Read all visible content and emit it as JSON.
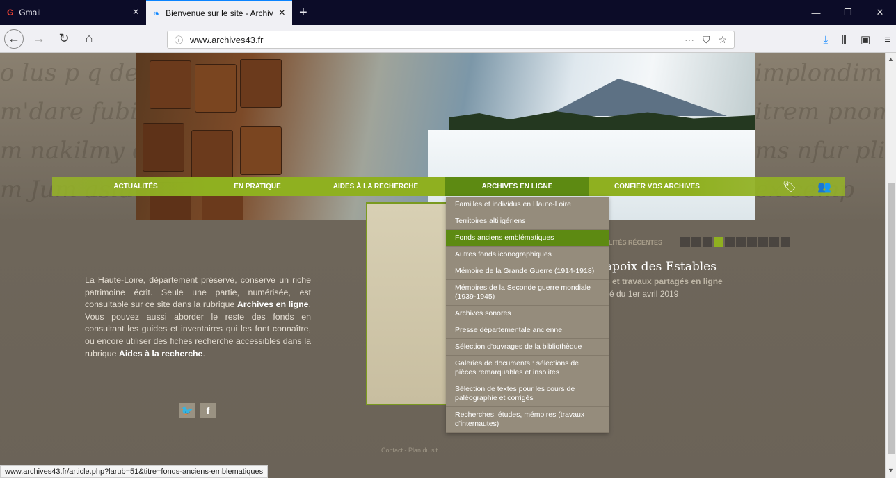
{
  "browser": {
    "tabs": [
      {
        "label": "Gmail",
        "icon": "google-icon"
      },
      {
        "label": "Bienvenue sur le site - Archives",
        "icon": "site-favicon"
      }
    ],
    "new_tab": "+",
    "url": "www.archives43.fr",
    "status_url": "www.archives43.fr/article.php?larub=51&titre=fonds-anciens-emblematiques"
  },
  "site": {
    "menu": [
      "ACTUALITÉS",
      "EN PRATIQUE",
      "AIDES À LA RECHERCHE",
      "ARCHIVES EN LIGNE",
      "CONFIER VOS ARCHIVES"
    ],
    "active_menu": "ARCHIVES EN LIGNE",
    "dropdown": [
      "Familles et individus en Haute-Loire",
      "Territoires altiligériens",
      "Fonds anciens emblématiques",
      "Autres fonds iconographiques",
      "Mémoire de la Grande Guerre (1914-1918)",
      "Mémoires de la Seconde guerre mondiale (1939-1945)",
      "Archives sonores",
      "Presse départementale ancienne",
      "Sélection d'ouvrages de la bibliothèque",
      "Galeries de documents : sélections de pièces remarquables et insolites",
      "Sélection de textes pour les cours de paléographie et corrigés",
      "Recherches, études, mémoires (travaux d'internautes)"
    ],
    "highlighted_item": "Fonds anciens emblématiques",
    "intro": {
      "part1": "La Haute-Loire, département préservé, conserve un riche patrimoine écrit. Seule une partie, numérisée, est consultable sur ce site dans la rubrique ",
      "link1": "Archives en ligne",
      "part2": ". Vous pouvez aussi aborder le reste des fonds en consultant les guides et inventaires qui les font connaître, ou encore utiliser des fiches recherche accessibles dans la rubrique ",
      "link2": "Aides à la recherche",
      "part3": "."
    },
    "social": [
      "twitter-icon",
      "facebook-icon"
    ],
    "news": {
      "section": "LITÉS RÉCENTES",
      "headline": "apoix des Estables",
      "subtitle": "s et travaux partagés en ligne",
      "date": "ité du 1er avril 2019"
    },
    "footer": "Contact - Plan du sit"
  },
  "colors": {
    "accent": "#8fb020",
    "accent_dark": "#5d8a12",
    "dropdown_bg": "#958c7c"
  }
}
